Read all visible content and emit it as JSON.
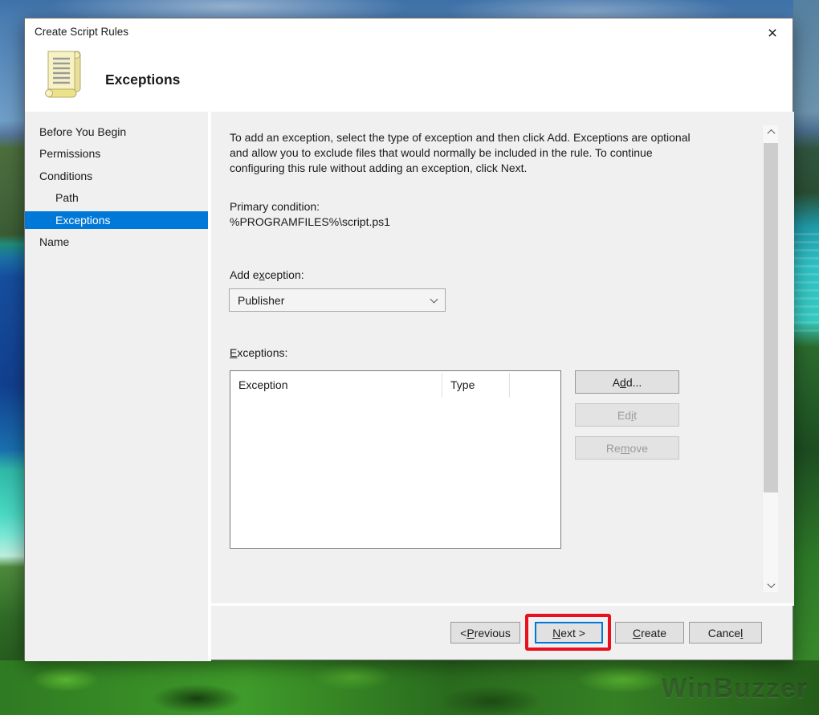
{
  "window": {
    "title": "Create Script Rules",
    "close_glyph": "×"
  },
  "header": {
    "heading": "Exceptions",
    "icon": "script-scroll-icon"
  },
  "sidebar": {
    "items": [
      {
        "label": "Before You Begin",
        "level": 0,
        "active": false
      },
      {
        "label": "Permissions",
        "level": 0,
        "active": false
      },
      {
        "label": "Conditions",
        "level": 0,
        "active": false
      },
      {
        "label": "Path",
        "level": 1,
        "active": false
      },
      {
        "label": "Exceptions",
        "level": 1,
        "active": true
      },
      {
        "label": "Name",
        "level": 0,
        "active": false
      }
    ]
  },
  "content": {
    "intro": "To add an exception, select the type of exception and then click Add. Exceptions are optional and allow you to exclude files that would normally be included in the rule. To continue configuring this rule without adding an exception, click Next.",
    "primary_condition": {
      "label": "Primary condition:",
      "value": "%PROGRAMFILES%\\script.ps1"
    },
    "add_exception": {
      "label": {
        "pre": "Add e",
        "key": "x",
        "post": "ception:"
      },
      "selected_value": "Publisher"
    },
    "exceptions_list": {
      "label": {
        "pre": "",
        "key": "E",
        "post": "xceptions:"
      },
      "columns": [
        "Exception",
        "Type"
      ],
      "rows": []
    },
    "side_buttons": [
      {
        "name": "add",
        "label": {
          "pre": "A",
          "key": "d",
          "post": "d..."
        },
        "enabled": true
      },
      {
        "name": "edit",
        "label": {
          "pre": "Ed",
          "key": "i",
          "post": "t"
        },
        "enabled": false
      },
      {
        "name": "remove",
        "label": {
          "pre": "Re",
          "key": "m",
          "post": "ove"
        },
        "enabled": false
      }
    ]
  },
  "footer": {
    "buttons": [
      {
        "name": "previous",
        "label": {
          "pre": "< ",
          "key": "P",
          "post": "revious"
        },
        "focused": false,
        "annotated": false
      },
      {
        "name": "next",
        "label": {
          "pre": "",
          "key": "N",
          "post": "ext >"
        },
        "focused": true,
        "annotated": true
      },
      {
        "name": "create",
        "label": {
          "pre": "",
          "key": "C",
          "post": "reate"
        },
        "focused": false,
        "annotated": false
      },
      {
        "name": "cancel",
        "label": {
          "pre": "Cance",
          "key": "l",
          "post": ""
        },
        "focused": false,
        "annotated": false
      }
    ]
  },
  "annotation": {
    "shape": "red-box",
    "color": "#e8101e",
    "target": "next-button"
  },
  "colors": {
    "accent": "#0078d7",
    "sidebar_highlight": "#0078d7",
    "annotation_red": "#e8101e",
    "panel": "#f0f0f0"
  },
  "desktop": {
    "watermark": "WinBuzzer"
  }
}
